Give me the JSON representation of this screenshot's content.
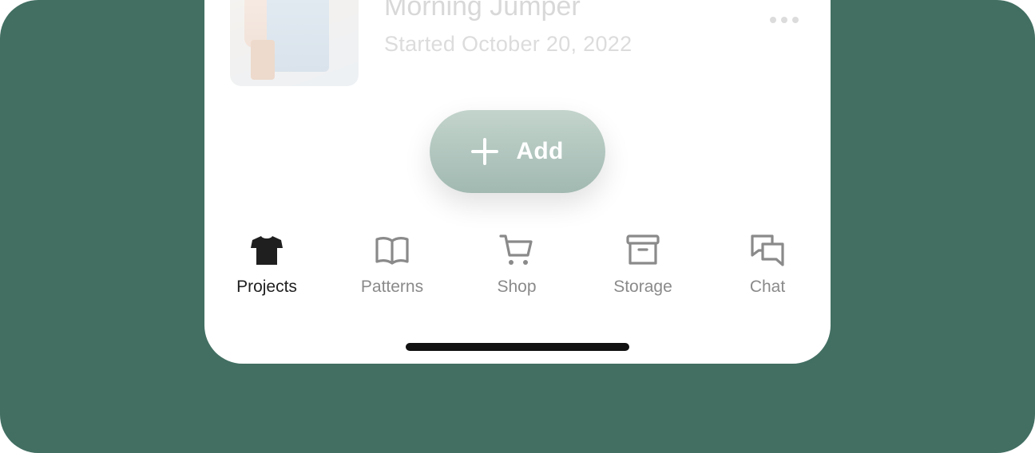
{
  "colors": {
    "background": "#426f62",
    "surface": "#ffffff",
    "add_button": "#a9c0b8",
    "tab_active": "#1f1f1f",
    "tab_inactive": "#8a8a8a"
  },
  "project_card": {
    "title": "Morning Jumper",
    "subtitle": "Started October 20, 2022",
    "thumbnail_icon": "project-photo",
    "more_icon": "more-horizontal-icon"
  },
  "add_button": {
    "label": "Add",
    "icon": "plus-icon"
  },
  "tabs": [
    {
      "label": "Projects",
      "icon": "tshirt-icon",
      "active": true
    },
    {
      "label": "Patterns",
      "icon": "book-icon",
      "active": false
    },
    {
      "label": "Shop",
      "icon": "cart-icon",
      "active": false
    },
    {
      "label": "Storage",
      "icon": "archive-icon",
      "active": false
    },
    {
      "label": "Chat",
      "icon": "chat-icon",
      "active": false
    }
  ]
}
